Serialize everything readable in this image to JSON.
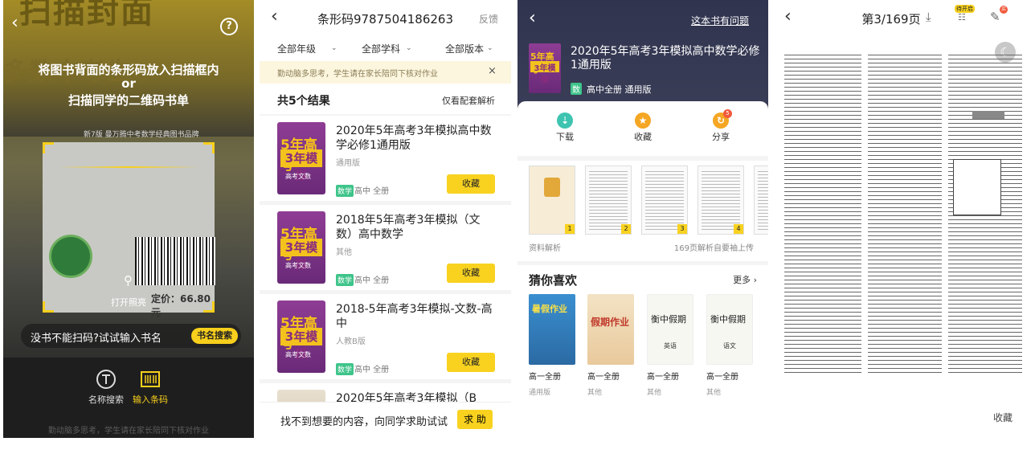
{
  "scan": {
    "instruction_line1": "将图书背面的条形码放入扫描框内",
    "instruction_or": "or",
    "instruction_line2": "扫描同学的二维码书单",
    "cover_text": "扫描封面",
    "cover_text2": "多数中考生",
    "cover_strip": "新7版 曼万腾中考数学经典图书品牌",
    "price_label": "定价：66.80元",
    "flashlight_label": "打开照亮",
    "no_book_prompt": "没书不能扫码?试试输入书名",
    "name_search_button": "书名搜索",
    "tool_name_search": "名称搜索",
    "tool_input_barcode": "输入条码",
    "footer_hint": "勤动脑多思考，学生请在家长陪同下核对作业",
    "accent": "#f8cf1c"
  },
  "results": {
    "title": "条形码9787504186263",
    "feedback": "反馈",
    "filters": [
      "全部年级",
      "全部学科",
      "全部版本"
    ],
    "notice": "勤动脑多思考，学生请在家长陪同下核对作业",
    "notice_close": "×",
    "count_label": "共5个结果",
    "only_supported": "仅看配套解析",
    "items": [
      {
        "name": "2020年5年高考3年模拟高中数学必修1通用版",
        "version": "通用版",
        "subject": "数学",
        "meta": "高中 全册",
        "button": "收藏"
      },
      {
        "name": "2018年5年高考3年模拟（文数）高中数学",
        "version": "其他",
        "subject": "数学",
        "meta": "高中 全册",
        "button": "收藏"
      },
      {
        "name": "2018-5年高考3年模拟-文数-高中",
        "version": "人教B版",
        "subject": "数学",
        "meta": "高中 全册",
        "button": "收藏"
      },
      {
        "name": "2020年5年高考3年模拟（B",
        "version": "",
        "subject": "",
        "meta": "",
        "button": ""
      }
    ],
    "cover_brand": "5年高考",
    "cover_brand2": "3年模拟",
    "cover_sub": "高考文数",
    "footer_text": "找不到想要的内容，向同学求助试试",
    "help_button": "求 助"
  },
  "detail": {
    "report_issue": "这本书有问题",
    "book_title": "2020年5年高考3年模拟高中数学必修1通用版",
    "subject_tag": "数",
    "info": "高中全册  通用版",
    "actions": [
      {
        "label": "下载",
        "icon": "download-icon",
        "color": "#3ec4b0"
      },
      {
        "label": "收藏",
        "icon": "star-icon",
        "color": "#f5a623"
      },
      {
        "label": "分享",
        "icon": "share-icon",
        "color": "#f5a623"
      }
    ],
    "share_badge": "5",
    "thumb_numbers": [
      "1",
      "2",
      "3",
      "4"
    ],
    "thumbs_label": "资料解析",
    "thumbs_right": "169页解析自要袖上传",
    "guess_title": "猜你喜欢",
    "more_label": "更多",
    "recommendations": [
      {
        "name": "高一全册",
        "version": "通用版",
        "cover": "暑假作业"
      },
      {
        "name": "高一全册",
        "version": "其他",
        "cover": "假期作业"
      },
      {
        "name": "高一全册",
        "version": "其他",
        "cover": "衡中假期"
      },
      {
        "name": "高一全册",
        "version": "其他",
        "cover": "衡中假期"
      }
    ],
    "rec_sub": [
      "英语",
      "语文"
    ],
    "cover_brand": "5年高考",
    "cover_brand2": "3年模拟"
  },
  "viewer": {
    "page_indicator": "第3/169页",
    "badge": "待开启",
    "red_badge": "买",
    "favorite": "收藏"
  }
}
